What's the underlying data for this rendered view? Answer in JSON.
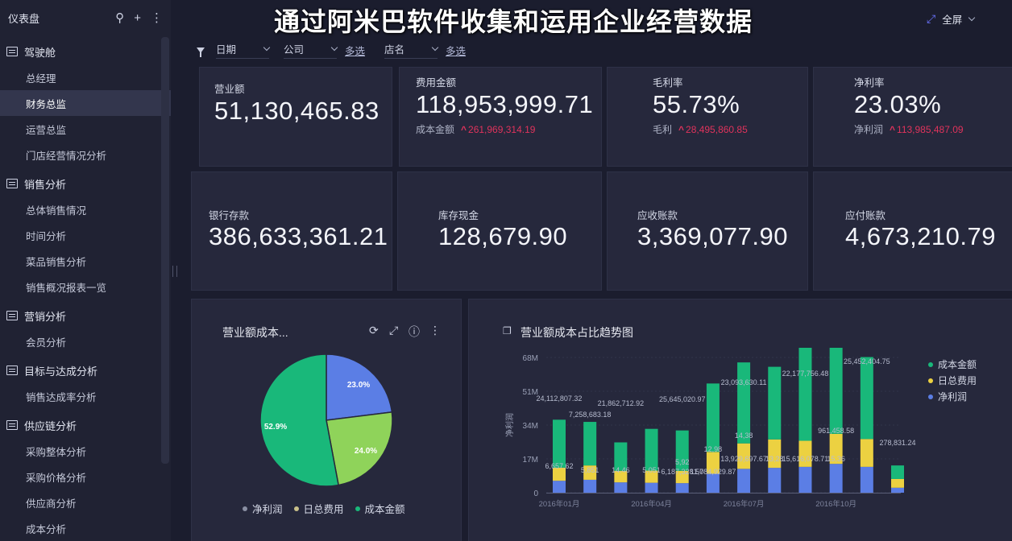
{
  "overlay_title": "通过阿米巴软件收集和运用企业经营数据",
  "sidebar": {
    "title": "仪表盘",
    "groups": [
      {
        "label": "驾驶舱",
        "items": [
          "总经理",
          "财务总监",
          "运营总监",
          "门店经营情况分析"
        ]
      },
      {
        "label": "销售分析",
        "items": [
          "总体销售情况",
          "时间分析",
          "菜品销售分析",
          "销售概况报表一览"
        ]
      },
      {
        "label": "营销分析",
        "items": [
          "会员分析"
        ]
      },
      {
        "label": "目标与达成分析",
        "items": [
          "销售达成率分析"
        ]
      },
      {
        "label": "供应链分析",
        "items": [
          "采购整体分析",
          "采购价格分析",
          "供应商分析",
          "成本分析"
        ]
      }
    ],
    "active_item": "财务总监"
  },
  "topbar": {
    "fullscreen_label": "全屏"
  },
  "filters": {
    "date_label": "日期",
    "company_label": "公司",
    "company_multi": "多选",
    "store_label": "店名",
    "store_multi": "多选"
  },
  "kpis": {
    "revenue": {
      "label": "营业额",
      "value": "51,130,465.83"
    },
    "expense": {
      "label": "费用金额",
      "value": "118,953,999.71",
      "sub_label": "成本金额",
      "sub_value": "261,969,314.19"
    },
    "gross_margin": {
      "label": "毛利率",
      "value": "55.73%",
      "sub_label": "毛利",
      "sub_value": "28,495,860.85"
    },
    "net_margin": {
      "label": "净利率",
      "value": "23.03%",
      "sub_label": "净利润",
      "sub_value": "113,985,487.09"
    },
    "bank_deposit": {
      "label": "银行存款",
      "value": "386,633,361.21"
    },
    "cash": {
      "label": "库存现金",
      "value": "128,679.90"
    },
    "receivable": {
      "label": "应收账款",
      "value": "3,369,077.90"
    },
    "payable": {
      "label": "应付账款",
      "value": "4,673,210.79"
    }
  },
  "colors": {
    "cost": "#19b87a",
    "expense": "#ecd141",
    "net_profit": "#5b7ee5",
    "pie_expense": "#8fd35a",
    "trend_up": "#e0335c"
  },
  "pie_panel": {
    "title": "营业额成本...",
    "icons": [
      "refresh-icon",
      "expand-icon",
      "info-icon",
      "more-icon"
    ]
  },
  "bar_panel": {
    "title": "营业额成本占比趋势图"
  },
  "chart_data": [
    {
      "type": "pie",
      "title": "营业额成本...",
      "slices": [
        {
          "name": "净利润",
          "value": 23.0,
          "label": "23.0%",
          "color": "#5b7ee5"
        },
        {
          "name": "日总费用",
          "value": 24.0,
          "label": "24.0%",
          "color": "#8fd35a"
        },
        {
          "name": "成本金额",
          "value": 52.9,
          "label": "52.9%",
          "color": "#19b87a"
        }
      ],
      "legend": [
        "净利润",
        "日总费用",
        "成本金额"
      ],
      "legend_position": "bottom"
    },
    {
      "type": "bar",
      "stacked": true,
      "title": "营业额成本占比趋势图",
      "ylabel": "净利润",
      "ylim": [
        0,
        68000000
      ],
      "yticks": [
        "68M",
        "51M",
        "34M",
        "17M",
        "0"
      ],
      "xtick_labels": [
        "2016年01月",
        "2016年04月",
        "2016年07月",
        "2016年10月"
      ],
      "categories": [
        "2016-01",
        "2016-02",
        "2016-03",
        "2016-04",
        "2016-05",
        "2016-06",
        "2016-07",
        "2016-08",
        "2016-09",
        "2016-10",
        "2016-11",
        "2016-12"
      ],
      "series": [
        {
          "name": "净利润",
          "color": "#5b7ee5",
          "values": [
            6000000,
            6500000,
            5200000,
            5000000,
            4800000,
            9500000,
            12000000,
            12500000,
            13000000,
            14500000,
            13000000,
            2500000
          ]
        },
        {
          "name": "日总费用",
          "color": "#ecd141",
          "values": [
            6600000,
            7200000,
            5800000,
            6100000,
            6200000,
            11000000,
            12800000,
            14300000,
            13100000,
            15100000,
            14000000,
            4400000
          ]
        },
        {
          "name": "成本金额",
          "color": "#19b87a",
          "values": [
            24100000,
            21900000,
            14300000,
            21000000,
            20300000,
            34400000,
            40700000,
            36500000,
            46900000,
            45100000,
            41200000,
            6800000
          ]
        }
      ],
      "data_labels": [
        "24,112,807.32",
        "7,258,683.18",
        "21,862,712.92",
        "25,645,020.97",
        "23,093,630.11",
        "22,177,756.48",
        "25,452,404.75",
        "278,831.24",
        "6,657,62",
        "5,851",
        "14.46",
        "5,051",
        "6,187,328.57",
        "5,92",
        "11,084,929.87",
        "12,98",
        "13,929,697.67",
        "14,38",
        "13,28",
        "15,616,078.71",
        "15,36",
        "961,458.58"
      ],
      "legend": [
        "成本金额",
        "日总费用",
        "净利润"
      ],
      "legend_position": "top-right"
    }
  ]
}
